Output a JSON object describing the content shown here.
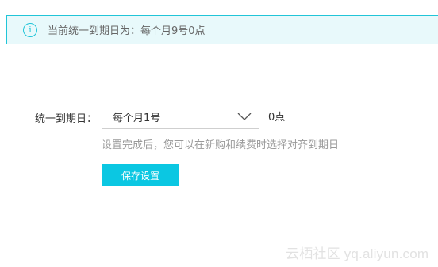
{
  "notice": {
    "text": "当前统一到期日为：每个月9号0点",
    "icon": "info-icon",
    "border_color": "#21c5d8",
    "background": "#e8f9fb"
  },
  "form": {
    "label": "统一到期日：",
    "select": {
      "selected": "每个月1号",
      "icon": "chevron-down-icon"
    },
    "unit": "0点",
    "hint": "设置完成后，您可以在新购和续费时选择对齐到期日"
  },
  "actions": {
    "save_label": "保存设置",
    "save_color": "#0bc7e2"
  },
  "watermark": "云栖社区 yq.aliyun.com"
}
